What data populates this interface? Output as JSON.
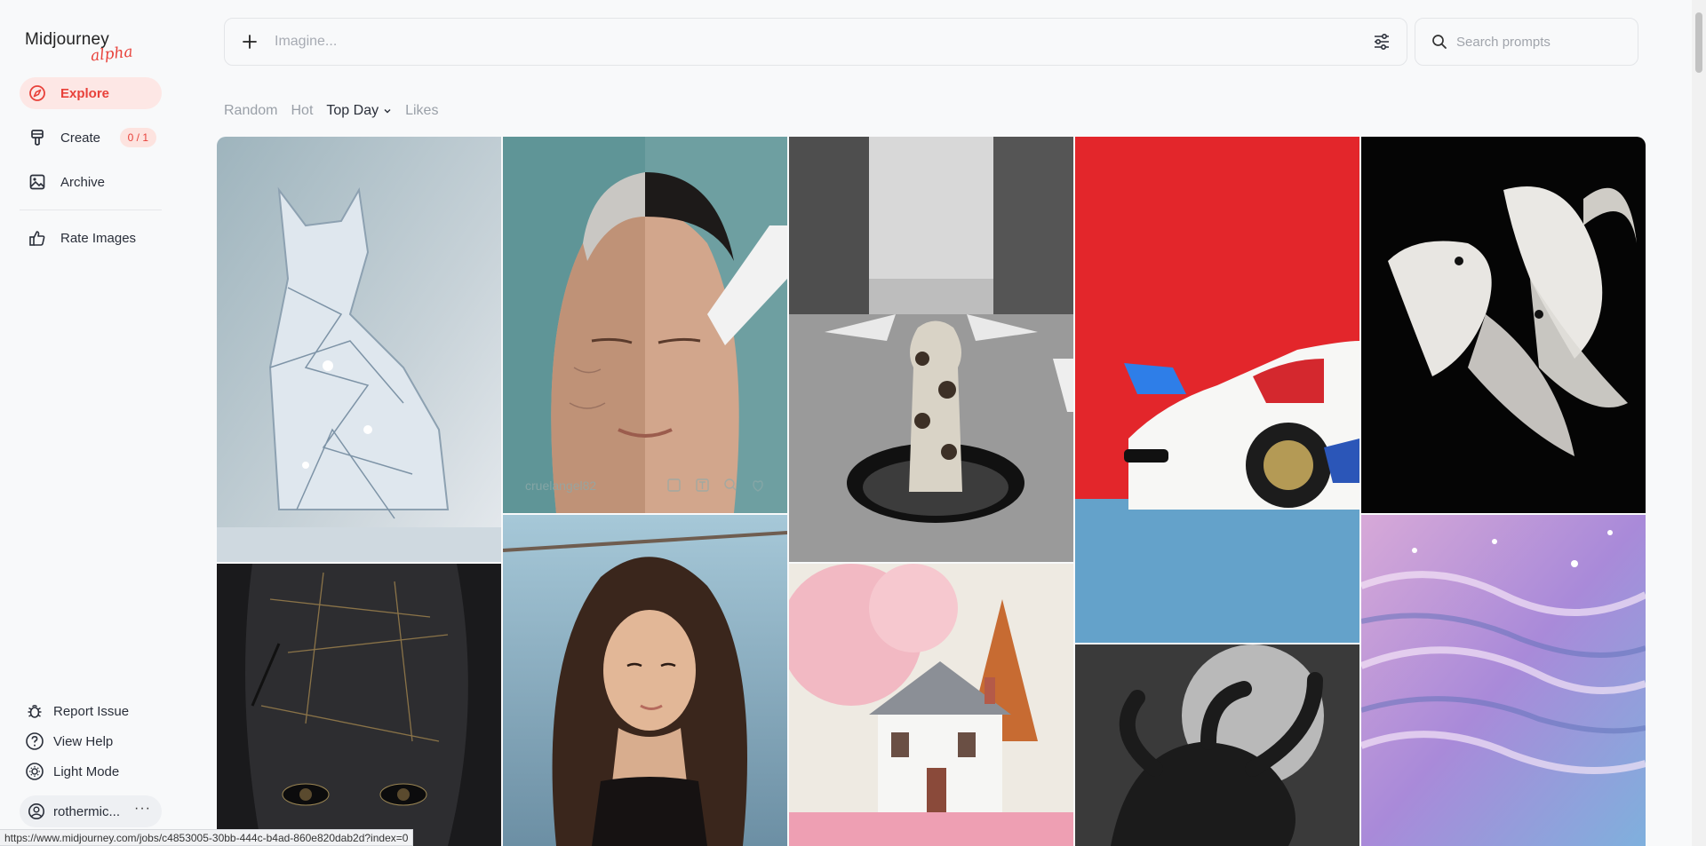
{
  "app": {
    "logo_text": "Midjourney",
    "logo_tag": "alpha"
  },
  "sidebar": {
    "items": [
      {
        "label": "Explore",
        "icon": "compass-icon"
      },
      {
        "label": "Create",
        "icon": "brush-icon",
        "badge": "0 / 1"
      },
      {
        "label": "Archive",
        "icon": "image-icon"
      },
      {
        "label": "Rate Images",
        "icon": "thumbs-up-icon"
      }
    ],
    "footer": [
      {
        "label": "Report Issue",
        "icon": "bug-icon"
      },
      {
        "label": "View Help",
        "icon": "help-icon"
      },
      {
        "label": "Light Mode",
        "icon": "sun-icon"
      }
    ],
    "user": {
      "name": "rothermic...",
      "more": "···"
    }
  },
  "topbar": {
    "imagine_placeholder": "Imagine...",
    "search_placeholder": "Search prompts"
  },
  "tabs": [
    {
      "label": "Random"
    },
    {
      "label": "Hot"
    },
    {
      "label": "Top Day"
    },
    {
      "label": "Likes"
    }
  ],
  "feed": {
    "hover_user": "cruelangel82",
    "images": [
      {
        "subject": "crystal cat"
      },
      {
        "subject": "aging face treatment"
      },
      {
        "subject": "giraffe in manhole"
      },
      {
        "subject": "white sports car"
      },
      {
        "subject": "white betta fish"
      },
      {
        "subject": "cracked stone face"
      },
      {
        "subject": "woman portrait"
      },
      {
        "subject": "cherry blossom house"
      },
      {
        "subject": "octopus moon"
      },
      {
        "subject": "pink water waves"
      }
    ]
  },
  "statusbar": {
    "url": "https://www.midjourney.com/jobs/c4853005-30bb-444c-b4ad-860e820dab2d?index=0"
  },
  "colors": {
    "accent": "#e8413a",
    "active_bg": "#fde7e5",
    "background": "#f8f9fa"
  }
}
